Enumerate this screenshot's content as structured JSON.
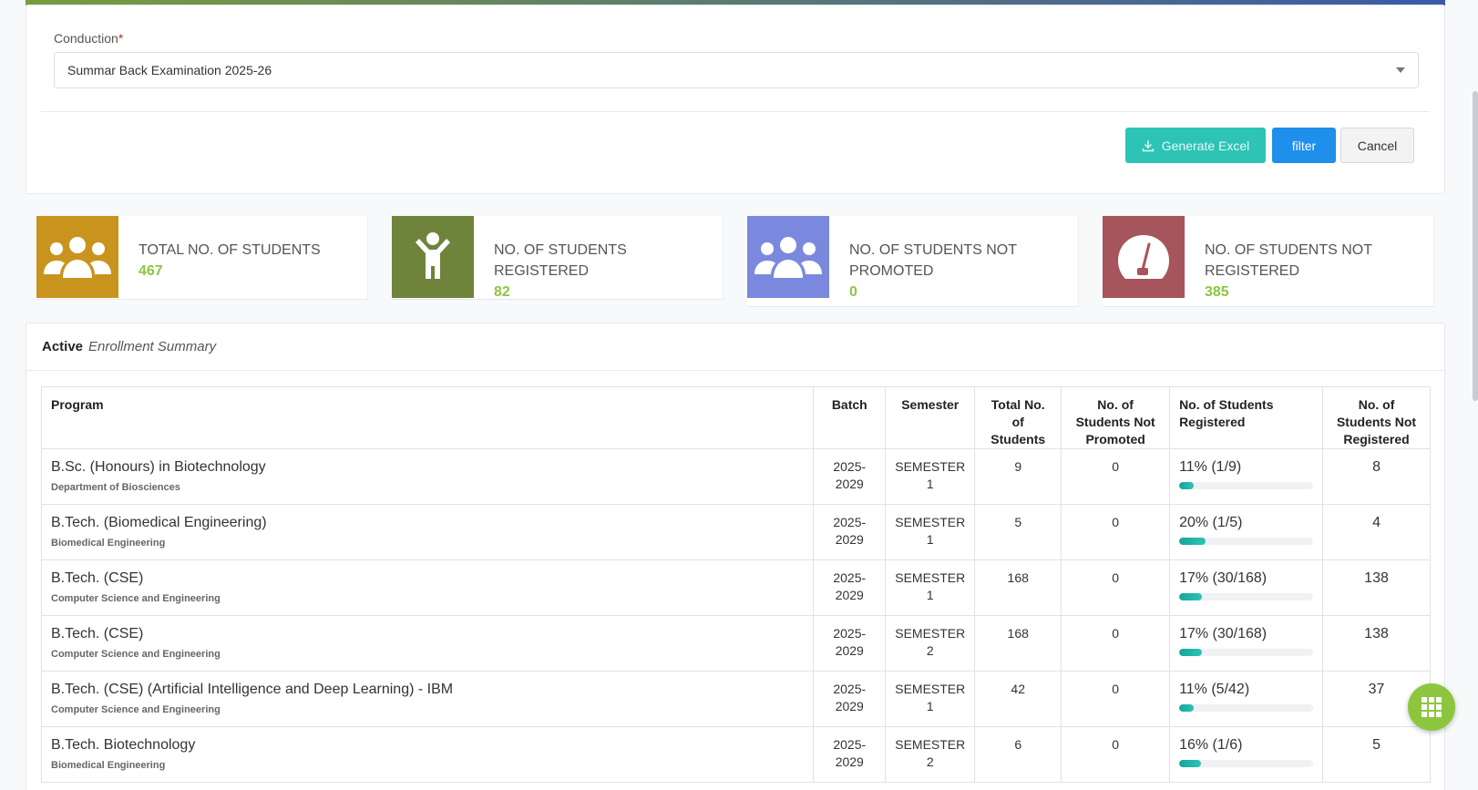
{
  "filter": {
    "conduction_label": "Conduction",
    "required_mark": "*",
    "conduction_value": "Summar Back Examination 2025-26",
    "generate_excel_label": "Generate Excel",
    "filter_label": "filter",
    "cancel_label": "Cancel"
  },
  "stats": [
    {
      "label": "TOTAL NO. OF STUDENTS",
      "value": "467",
      "color": "#c9941e",
      "icon": "users-group-icon"
    },
    {
      "label": "NO. OF STUDENTS REGISTERED",
      "value": "82",
      "color": "#6e843b",
      "icon": "person-cheer-icon"
    },
    {
      "label": "NO. OF STUDENTS NOT PROMOTED",
      "value": "0",
      "color": "#7a88de",
      "icon": "users-group-icon"
    },
    {
      "label": "NO. OF STUDENTS NOT REGISTERED",
      "value": "385",
      "color": "#a5555b",
      "icon": "gauge-icon"
    }
  ],
  "summary": {
    "title_bold": "Active",
    "title_italic": "Enrollment Summary",
    "columns": [
      "Program",
      "Batch",
      "Semester",
      "Total No. of Students",
      "No. of Students Not Promoted",
      "No. of Students Registered",
      "No. of Students Not Registered"
    ],
    "rows": [
      {
        "program": "B.Sc. (Honours) in Biotechnology",
        "dept": "Department of Biosciences",
        "batch": "2025-2029",
        "semester": "SEMESTER 1",
        "total": "9",
        "not_promoted": "0",
        "registered": "11% (1/9)",
        "pct": 11,
        "not_registered": "8"
      },
      {
        "program": "B.Tech. (Biomedical Engineering)",
        "dept": "Biomedical Engineering",
        "batch": "2025-2029",
        "semester": "SEMESTER 1",
        "total": "5",
        "not_promoted": "0",
        "registered": "20% (1/5)",
        "pct": 20,
        "not_registered": "4"
      },
      {
        "program": "B.Tech. (CSE)",
        "dept": "Computer Science and Engineering",
        "batch": "2025-2029",
        "semester": "SEMESTER 1",
        "total": "168",
        "not_promoted": "0",
        "registered": "17% (30/168)",
        "pct": 17,
        "not_registered": "138"
      },
      {
        "program": "B.Tech. (CSE)",
        "dept": "Computer Science and Engineering",
        "batch": "2025-2029",
        "semester": "SEMESTER 2",
        "total": "168",
        "not_promoted": "0",
        "registered": "17% (30/168)",
        "pct": 17,
        "not_registered": "138"
      },
      {
        "program": "B.Tech. (CSE) (Artificial Intelligence and Deep Learning) - IBM",
        "dept": "Computer Science and Engineering",
        "batch": "2025-2029",
        "semester": "SEMESTER 1",
        "total": "42",
        "not_promoted": "0",
        "registered": "11% (5/42)",
        "pct": 11,
        "not_registered": "37"
      },
      {
        "program": "B.Tech. Biotechnology",
        "dept": "Biomedical Engineering",
        "batch": "2025-2029",
        "semester": "SEMESTER 2",
        "total": "6",
        "not_promoted": "0",
        "registered": "16% (1/6)",
        "pct": 16,
        "not_registered": "5"
      }
    ]
  },
  "fab": {
    "icon": "grid-menu-icon"
  }
}
